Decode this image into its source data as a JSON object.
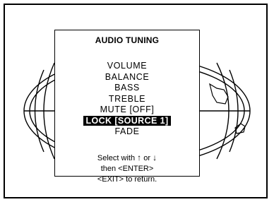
{
  "dialog": {
    "title": "AUDIO TUNING",
    "items": [
      {
        "label": "VOLUME",
        "selected": false
      },
      {
        "label": "BALANCE",
        "selected": false
      },
      {
        "label": "BASS",
        "selected": false
      },
      {
        "label": "TREBLE",
        "selected": false
      },
      {
        "label": "MUTE [OFF]",
        "selected": false
      },
      {
        "label": "LOCK [SOURCE 1]",
        "selected": true
      },
      {
        "label": "FADE",
        "selected": false
      }
    ],
    "help": {
      "select_prefix": "Select with",
      "up_arrow": "↑",
      "or": "or",
      "down_arrow": "↓",
      "line2": "then <ENTER>",
      "line3": "<EXIT> to return."
    }
  },
  "colors": {
    "foreground": "#000000",
    "background": "#ffffff",
    "selected_bg": "#000000",
    "selected_fg": "#ffffff"
  }
}
